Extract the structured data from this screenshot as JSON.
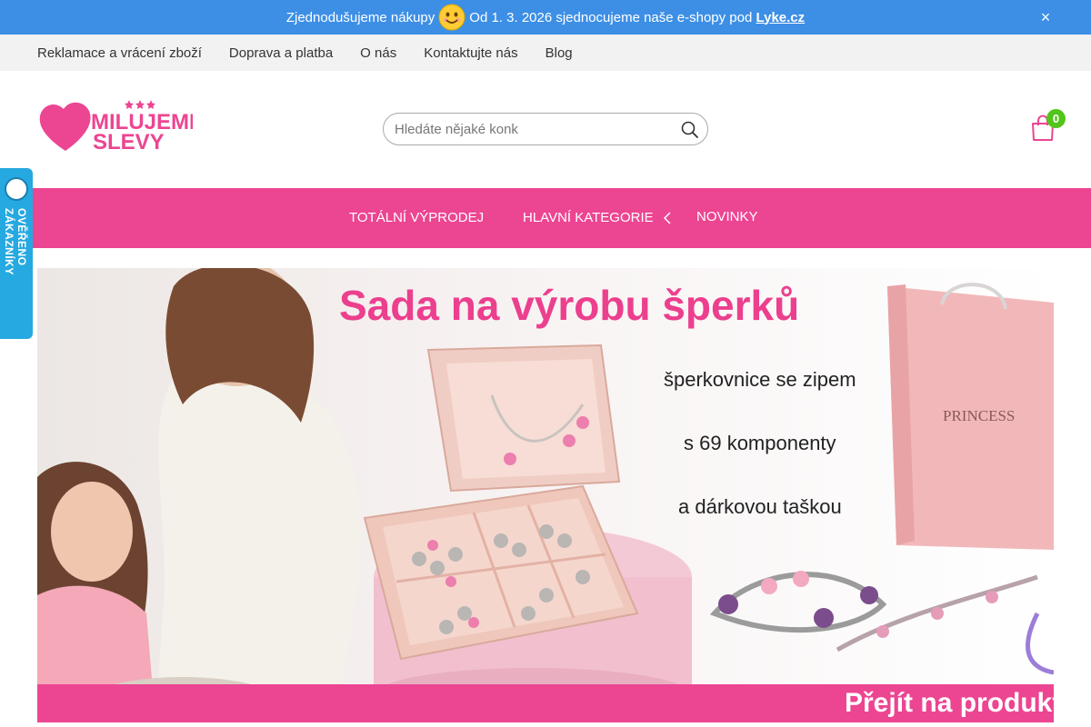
{
  "announcement": {
    "text_before": "Zjednodušujeme nákupy",
    "text_after": "Od 1. 3. 2026 sjednocujeme naše e-shopy pod",
    "link_text": "Lyke.cz",
    "close_label": "×"
  },
  "topnav": {
    "items": [
      {
        "label": "Reklamace a vrácení zboží"
      },
      {
        "label": "Doprava a platba"
      },
      {
        "label": "O nás"
      },
      {
        "label": "Kontaktujte nás"
      },
      {
        "label": "Blog"
      }
    ]
  },
  "logo": {
    "line1": "MILUJEME",
    "line2": "SLEVY"
  },
  "search": {
    "placeholder": "Hledáte nějaké konk",
    "value": ""
  },
  "cart": {
    "count": "0"
  },
  "mainnav": {
    "items": [
      {
        "label": "TOTÁLNÍ VÝPRODEJ"
      },
      {
        "label": "HLAVNÍ KATEGORIE"
      },
      {
        "label": "NOVINKY"
      }
    ]
  },
  "verified_badge": {
    "label": "OVĚŘENO ZÁKAZNÍKY"
  },
  "banner": {
    "title": "Sada na výrobu šperků",
    "line1": "šperkovnice se zipem",
    "line2": "s 69 komponenty",
    "line3": "a dárkovou taškou",
    "bag_label": "PRINCESS",
    "cta": "Přejít na produkt"
  },
  "colors": {
    "announce_bg": "#3d8fe6",
    "accent_pink": "#ec4592",
    "badge_green": "#52c41a",
    "verified_blue": "#25a9e0"
  }
}
